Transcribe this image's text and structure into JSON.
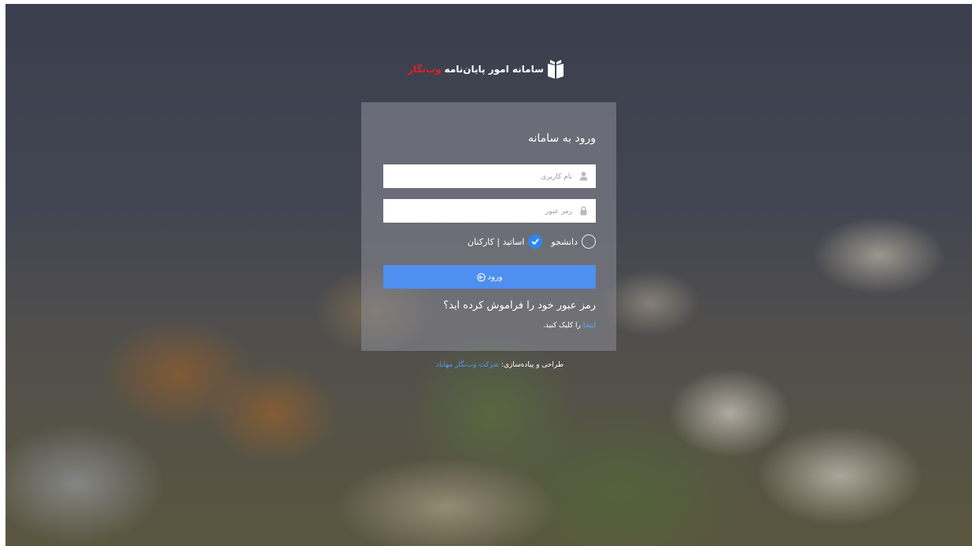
{
  "header": {
    "title": "سامانه امور پایان‌نامه",
    "brand_accent": "وب‌نگار",
    "logo_icon": "book-icon"
  },
  "login": {
    "heading": "ورود به سامانه",
    "username_placeholder": "نام کاربری",
    "password_placeholder": "رمز عبور",
    "roles": [
      {
        "label": "دانشجو",
        "selected": false
      },
      {
        "label": "اساتید | کارکنان",
        "selected": true
      }
    ],
    "submit_label": "ورود",
    "forgot_heading": "رمز عبور خود را فراموش کرده اید؟",
    "forgot_link": "اینجا",
    "forgot_suffix": "را کلیک کنید."
  },
  "footer": {
    "credit_prefix": "طراحی و پیاده‌سازی:",
    "company": "شرکت وب‌نگار مهاباد"
  },
  "colors": {
    "accent_blue": "#4f8ff0",
    "brand_red": "#e11f29",
    "link_blue": "#5aa8ff"
  }
}
